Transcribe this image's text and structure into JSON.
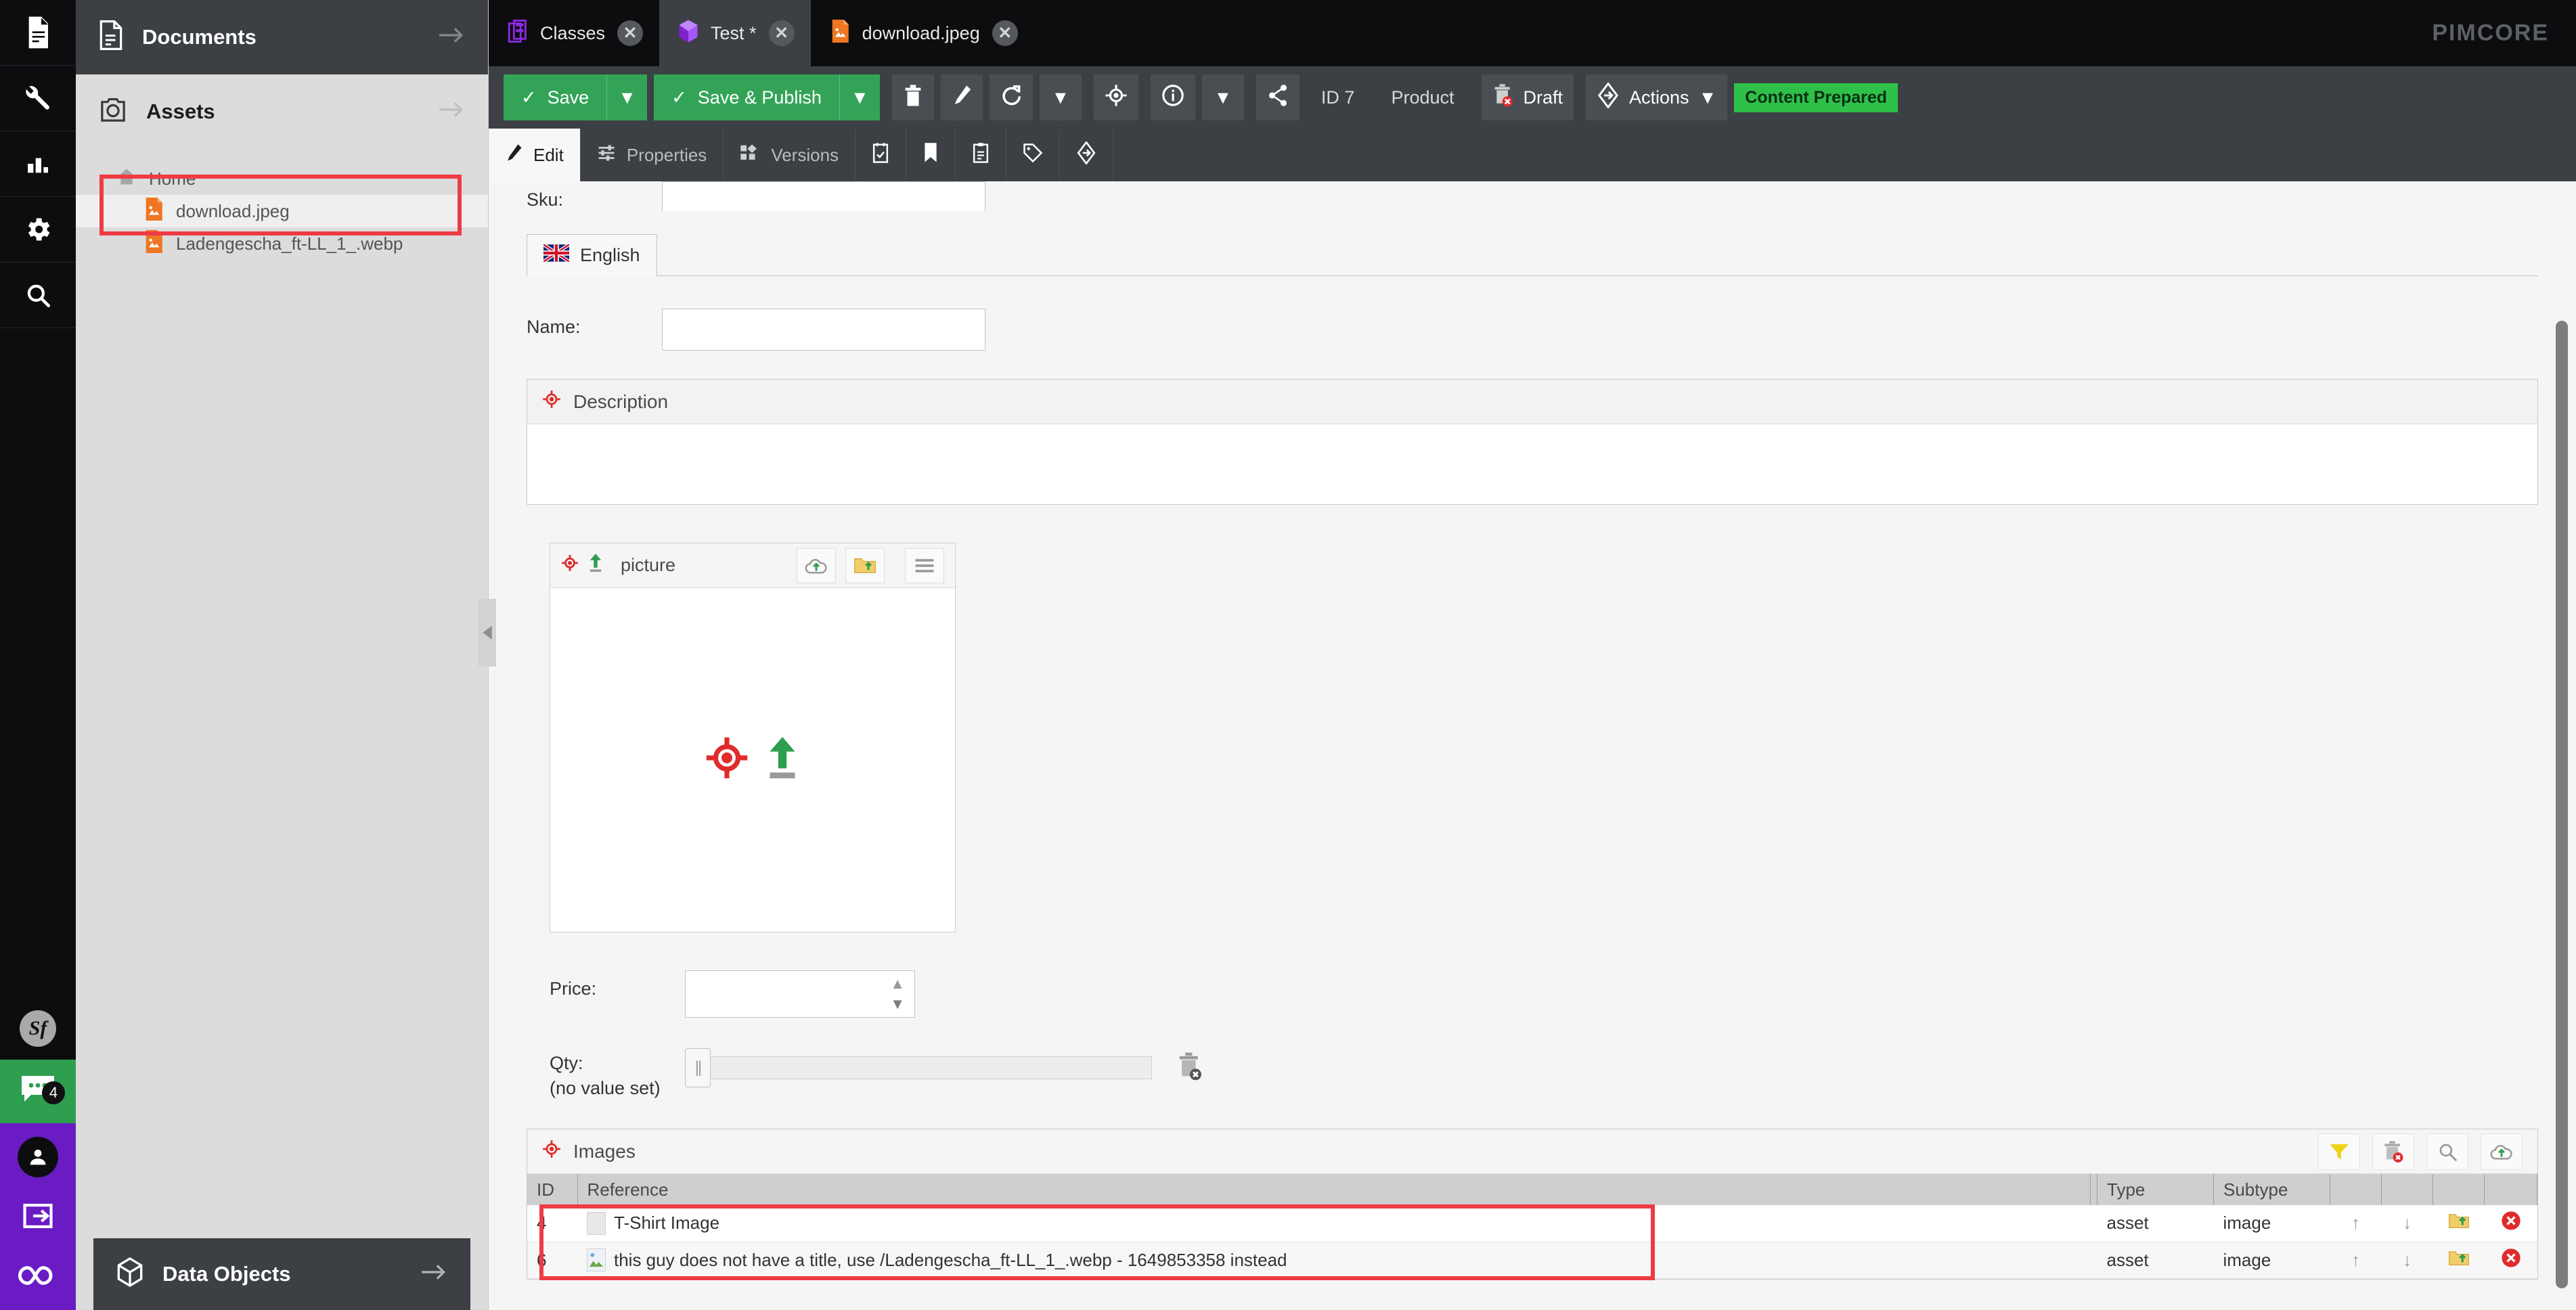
{
  "app": {
    "brand": "PIMCORE"
  },
  "rail": {
    "items": [
      {
        "name": "documents-icon",
        "label": "Documents"
      },
      {
        "name": "tools-icon",
        "label": "Tools"
      },
      {
        "name": "reports-icon",
        "label": "Reports"
      },
      {
        "name": "settings-icon",
        "label": "Settings"
      },
      {
        "name": "search-icon",
        "label": "Search"
      }
    ],
    "symfony": {
      "label": "Sf"
    },
    "chat": {
      "badge": "4"
    },
    "user": {
      "label": "Profile"
    },
    "logout": {
      "label": "Logout"
    },
    "infinity": {
      "label": "Pimcore"
    }
  },
  "left_panel": {
    "documents": {
      "title": "Documents",
      "icon": "document-icon"
    },
    "assets": {
      "title": "Assets",
      "icon": "asset-camera-icon"
    },
    "tree": {
      "root": "Home",
      "items": [
        {
          "label": "download.jpeg",
          "icon": "image-file-icon",
          "selected": true
        },
        {
          "label": "Ladengescha_ft-LL_1_.webp",
          "icon": "image-file-icon",
          "selected": false
        }
      ]
    },
    "data_objects": {
      "title": "Data Objects",
      "icon": "cube-icon"
    }
  },
  "editor_tabs": [
    {
      "label": "Classes",
      "icon": "class-icon",
      "active": false,
      "close": "✕"
    },
    {
      "label": "Test *",
      "icon": "object-cube-icon",
      "active": true,
      "close": "✕"
    },
    {
      "label": "download.jpeg",
      "icon": "image-file-icon",
      "active": false,
      "close": "✕"
    }
  ],
  "toolbar": {
    "save_label": "Save",
    "save_publish_label": "Save & Publish",
    "dropdown_caret": "▼",
    "check": "✓",
    "delete_icon": "trash-icon",
    "rename_icon": "pencil-icon",
    "reload_icon": "reload-icon",
    "target_icon": "target-icon",
    "info_icon": "info-icon",
    "share_icon": "share-icon",
    "id_label": "ID 7",
    "class_label": "Product",
    "draft_label": "Draft",
    "actions_label": "Actions",
    "status_badge": "Content Prepared",
    "badge_color": "#2fc04a"
  },
  "subtabs": [
    {
      "label": "Edit",
      "icon": "pencil-icon",
      "active": true
    },
    {
      "label": "Properties",
      "icon": "sliders-icon",
      "active": false
    },
    {
      "label": "Versions",
      "icon": "versions-icon",
      "active": false
    },
    {
      "label": "",
      "icon": "schedule-icon",
      "active": false
    },
    {
      "label": "",
      "icon": "bookmark-icon",
      "active": false
    },
    {
      "label": "",
      "icon": "clipboard-icon",
      "active": false
    },
    {
      "label": "",
      "icon": "tag-icon",
      "active": false
    },
    {
      "label": "",
      "icon": "workflow-icon",
      "active": false
    }
  ],
  "form": {
    "sku": {
      "label": "Sku:",
      "value": ""
    },
    "language_tab": {
      "label": "English",
      "icon": "uk-flag-icon"
    },
    "name": {
      "label": "Name:",
      "value": "",
      "placeholder": ""
    },
    "description": {
      "title": "Description",
      "icon": "inherit-target-icon",
      "value": ""
    },
    "picture": {
      "title": "picture",
      "inherit_icon": "inherit-target-icon",
      "upload_icon": "upload-arrow-icon",
      "cloud_upload_icon": "cloud-upload-icon",
      "folder_upload_icon": "folder-upload-icon",
      "menu_icon": "hamburger-icon",
      "drop_target_icon": "target-icon",
      "drop_upload_icon": "upload-arrow-icon"
    },
    "price": {
      "label": "Price:",
      "value": "",
      "up": "▲",
      "down": "▼"
    },
    "qty": {
      "label": "Qty:",
      "sublabel": "(no value set)",
      "value": "",
      "clear_icon": "clear-slider-icon"
    }
  },
  "images_block": {
    "title": "Images",
    "icon": "inherit-target-icon",
    "toolbar_icons": [
      {
        "name": "filter-icon"
      },
      {
        "name": "empty-trash-icon"
      },
      {
        "name": "search-icon"
      },
      {
        "name": "cloud-upload-icon"
      }
    ],
    "columns": [
      "ID",
      "Reference",
      "",
      "Type",
      "Subtype",
      "",
      "",
      "",
      ""
    ],
    "rows": [
      {
        "id": "4",
        "reference": "T-Shirt Image",
        "reference_icon": "tshirt-thumb-icon",
        "type": "asset",
        "subtype": "image",
        "up": "↑",
        "down": "↓",
        "open": "folder-open-icon",
        "remove": "remove-icon"
      },
      {
        "id": "6",
        "reference": "this guy does not have a title, use /Ladengescha_ft-LL_1_.webp - 1649853358 instead",
        "reference_icon": "broken-image-thumb-icon",
        "type": "asset",
        "subtype": "image",
        "up": "↑",
        "down": "↓",
        "open": "folder-open-icon",
        "remove": "remove-icon"
      }
    ]
  },
  "annotations": {
    "color": "#ef3b43",
    "boxes": [
      {
        "name": "annotation-tree-selection"
      },
      {
        "name": "annotation-images-rows"
      }
    ]
  }
}
